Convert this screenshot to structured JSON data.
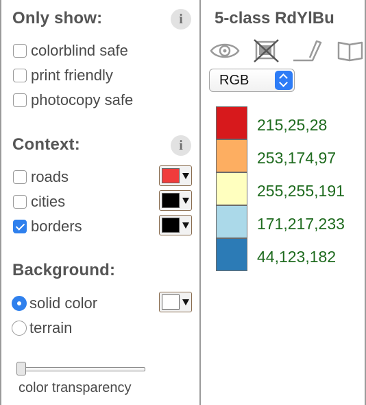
{
  "filters": {
    "title": "Only show:",
    "info_glyph": "i",
    "options": [
      {
        "label": "colorblind safe",
        "checked": false
      },
      {
        "label": "print friendly",
        "checked": false
      },
      {
        "label": "photocopy safe",
        "checked": false
      }
    ]
  },
  "context": {
    "title": "Context:",
    "info_glyph": "i",
    "layers": [
      {
        "label": "roads",
        "checked": false,
        "color": "#f03c3c"
      },
      {
        "label": "cities",
        "checked": false,
        "color": "#000000"
      },
      {
        "label": "borders",
        "checked": true,
        "color": "#000000"
      }
    ]
  },
  "background": {
    "title": "Background:",
    "options": [
      {
        "label": "solid color",
        "selected": true,
        "color": "#ffffff"
      },
      {
        "label": "terrain",
        "selected": false
      }
    ]
  },
  "transparency": {
    "label": "color transparency",
    "value_fraction": 0.0
  },
  "scheme": {
    "title": "5-class RdYlBu",
    "tools": [
      {
        "name": "eye-icon"
      },
      {
        "name": "crossed-out-screen-icon"
      },
      {
        "name": "laptop-icon"
      },
      {
        "name": "book-icon"
      }
    ],
    "format_select": {
      "value": "RGB"
    },
    "classes": [
      {
        "color": "#d7191c",
        "label": "215,25,28"
      },
      {
        "color": "#fdae61",
        "label": "253,174,97"
      },
      {
        "color": "#ffffbf",
        "label": "255,255,191"
      },
      {
        "color": "#abd9e9",
        "label": "171,217,233"
      },
      {
        "color": "#2c7bb6",
        "label": "44,123,182"
      }
    ]
  }
}
